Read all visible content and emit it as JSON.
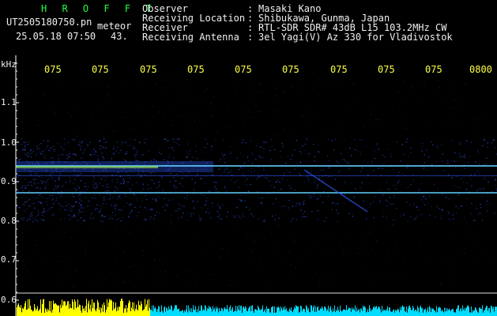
{
  "header": {
    "title": "H R O F F T",
    "filename": "UT2505180750.pn",
    "tag": "meteor",
    "datetime": "25.05.18 07:50",
    "count": "43.",
    "info": [
      {
        "key": "Observer",
        "value": "Masaki Kano"
      },
      {
        "key": "Receiving Location",
        "value": "Shibukawa, Gunma, Japan"
      },
      {
        "key": "Receiver",
        "value": "RTL-SDR SDR# 43dB L15 103.2MHz CW"
      },
      {
        "key": "Receiving Antenna",
        "value": "3el Yagi(V) Az 330 for Vladivostok"
      }
    ],
    "separator": ":"
  },
  "axes": {
    "y_unit": "kHz",
    "y_ticks": [
      "1.1",
      "1.0",
      "0.9",
      "0.8",
      "0.7",
      "0.6"
    ],
    "x_ticks": [
      "075",
      "075",
      "075",
      "075",
      "075",
      "075",
      "075",
      "075",
      "075",
      "0800"
    ]
  },
  "colors": {
    "background": "#000000",
    "grid_tick": "#ffffff",
    "signal_blue": "#2f5bff",
    "signal_cyan": "#60d0ff",
    "signal_green": "#aaff55",
    "level_yellow": "#ffff00",
    "level_cyan": "#00ddff"
  }
}
